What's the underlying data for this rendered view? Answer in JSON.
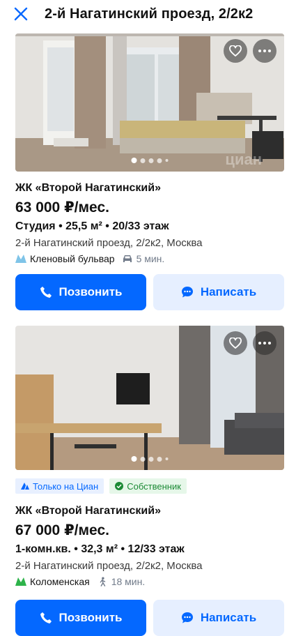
{
  "header": {
    "title": "2-й Нагатинский проезд, 2/2к2"
  },
  "listings": [
    {
      "complex": "ЖК «Второй Нагатинский»",
      "price": "63 000 ₽/мес.",
      "params": "Студия  •  25,5 м²  •  20/33 этаж",
      "address": "2-й Нагатинский проезд, 2/2к2, Москва",
      "metro": "Кленовый бульвар",
      "metro_color": "#7fc4e8",
      "transport": "car-icon",
      "time": "5 мин.",
      "watermark": "циан"
    },
    {
      "badges": [
        "Только на Циан",
        "Собственник"
      ],
      "complex": "ЖК «Второй Нагатинский»",
      "price": "67 000 ₽/мес.",
      "params": "1-комн.кв.  •  32,3 м²  •  12/33 этаж",
      "address": "2-й Нагатинский проезд, 2/2к2, Москва",
      "metro": "Коломенская",
      "metro_color": "#2db34a",
      "transport": "walk-icon",
      "time": "18 мин."
    }
  ],
  "buttons": {
    "call": "Позвонить",
    "write": "Написать"
  },
  "colors": {
    "accent": "#0468ff",
    "accent_light": "#e6efff"
  }
}
